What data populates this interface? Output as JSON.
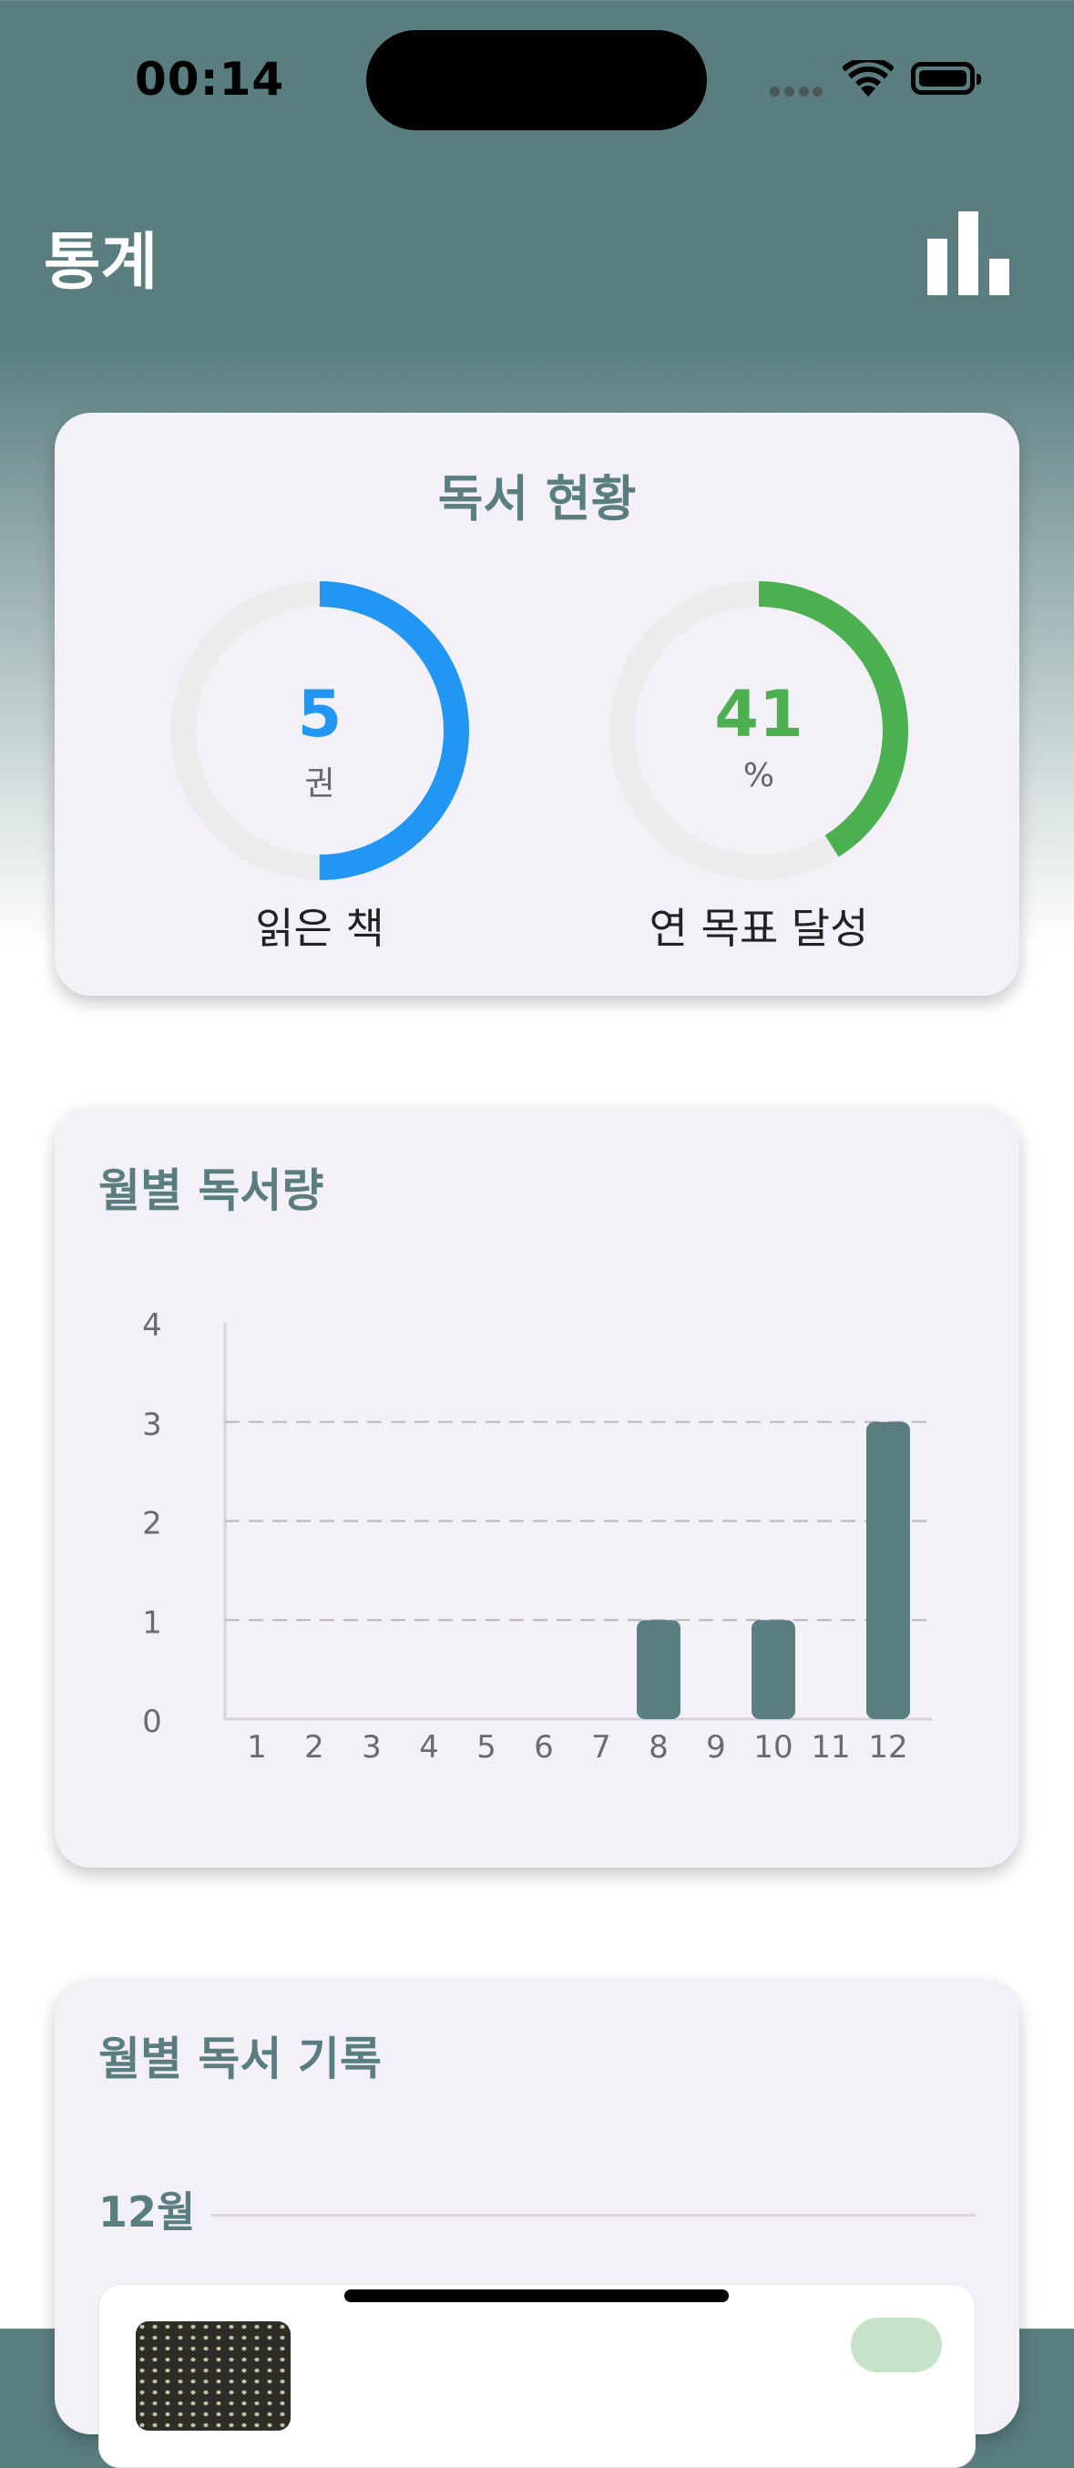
{
  "status_bar": {
    "time": "00:14"
  },
  "nav": {
    "title": "통계",
    "stats_icon": "bar-chart-icon"
  },
  "summary": {
    "title": "독서 현황",
    "books_read": {
      "value": "5",
      "unit": "권",
      "label": "읽은 책",
      "fraction": 0.5,
      "color": "#2196f3"
    },
    "annual_goal": {
      "value": "41",
      "unit": "%",
      "label": "연 목표 달성",
      "fraction": 0.41,
      "color": "#4caf50"
    }
  },
  "monthly": {
    "title": "월별 독서량",
    "chart_data": {
      "type": "bar",
      "categories": [
        "1",
        "2",
        "3",
        "4",
        "5",
        "6",
        "7",
        "8",
        "9",
        "10",
        "11",
        "12"
      ],
      "values": [
        0,
        0,
        0,
        0,
        0,
        0,
        0,
        1,
        0,
        1,
        0,
        3
      ],
      "yticks": [
        "0",
        "1",
        "2",
        "3",
        "4"
      ],
      "ylim": [
        0,
        4
      ],
      "grid": "dashed horizontal",
      "bar_color": "#5a7e80"
    }
  },
  "records": {
    "title": "월별 독서 기록",
    "month": "12월"
  }
}
